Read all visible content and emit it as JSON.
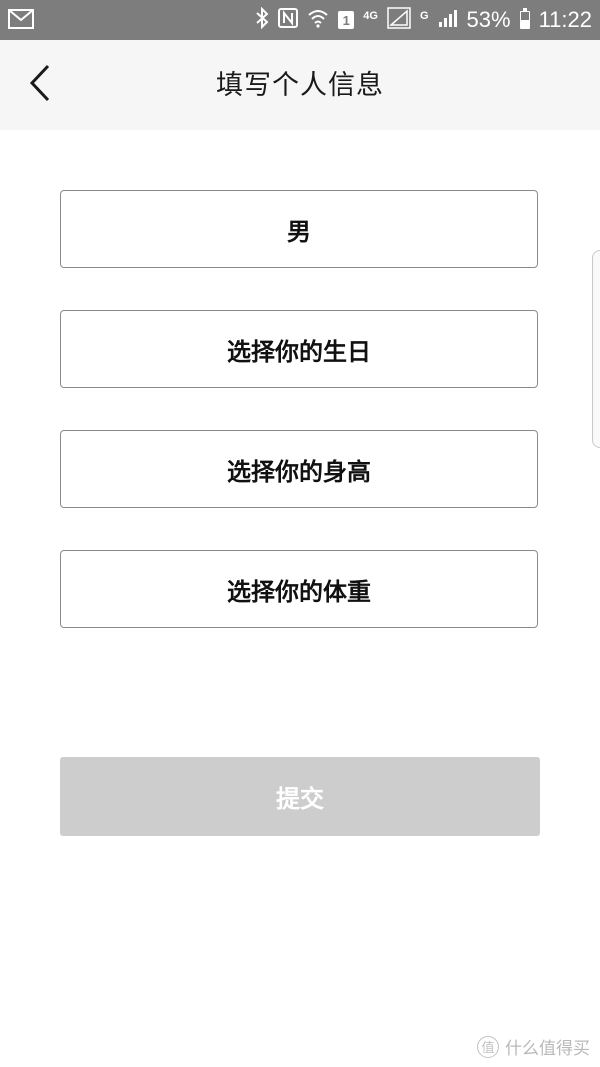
{
  "status_bar": {
    "icons": [
      "mail-icon",
      "bluetooth-icon",
      "nfc-icon",
      "wifi-icon",
      "sim-1-icon",
      "4g-signal-icon",
      "g-signal-icon",
      "battery-icon"
    ],
    "sim_label": "1",
    "net_4g": "4G",
    "net_g": "G",
    "battery": "53%",
    "time": "11:22",
    "battery_level": 0.53
  },
  "header": {
    "title": "填写个人信息",
    "back_icon": "chevron-left-icon"
  },
  "form": {
    "gender": "男",
    "birthday_placeholder": "选择你的生日",
    "height_placeholder": "选择你的身高",
    "weight_placeholder": "选择你的体重"
  },
  "submit": {
    "label": "提交",
    "disabled_color": "#cdcdcd"
  },
  "watermark": {
    "text": "什么值得买",
    "badge": "值"
  }
}
